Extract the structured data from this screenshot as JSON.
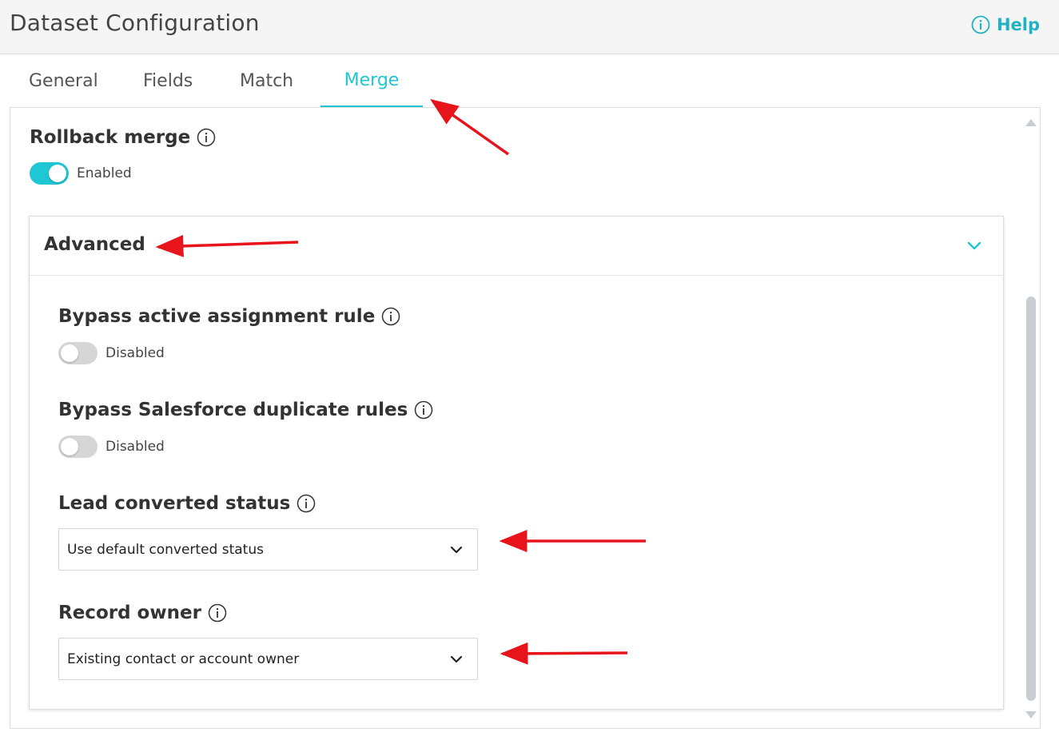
{
  "header": {
    "title": "Dataset Configuration",
    "help_label": "Help"
  },
  "tabs": [
    {
      "label": "General",
      "active": false
    },
    {
      "label": "Fields",
      "active": false
    },
    {
      "label": "Match",
      "active": false
    },
    {
      "label": "Merge",
      "active": true
    }
  ],
  "rollback": {
    "label": "Rollback merge",
    "state_label": "Enabled",
    "enabled": true
  },
  "advanced": {
    "title": "Advanced",
    "expanded": true,
    "bypass_assignment": {
      "label": "Bypass active assignment rule",
      "state_label": "Disabled",
      "enabled": false
    },
    "bypass_duplicate": {
      "label": "Bypass Salesforce duplicate rules",
      "state_label": "Disabled",
      "enabled": false
    },
    "lead_status": {
      "label": "Lead converted status",
      "selected": "Use default converted status"
    },
    "record_owner": {
      "label": "Record owner",
      "selected": "Existing contact or account owner"
    }
  },
  "colors": {
    "accent": "#1fc6d4",
    "help": "#1fb2c2",
    "annotation_arrow": "#e8141b",
    "toggle_off": "#d6d6d6"
  },
  "icons": [
    "info-icon",
    "chevron-down-icon",
    "scroll-up-arrow",
    "scroll-down-arrow"
  ]
}
